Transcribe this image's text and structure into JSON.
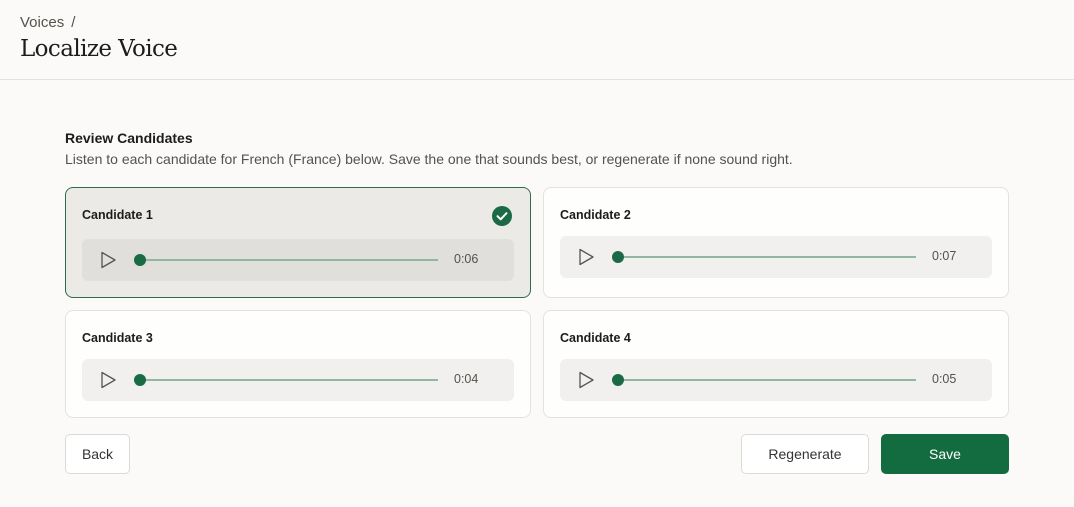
{
  "header": {
    "breadcrumb": "Voices",
    "breadcrumb_separator": "/",
    "title": "Localize Voice"
  },
  "review": {
    "title": "Review Candidates",
    "description": "Listen to each candidate for French (France) below. Save the one that sounds best, or regenerate if none sound right."
  },
  "candidates": [
    {
      "label": "Candidate 1",
      "duration": "0:06",
      "selected": true,
      "progress": 0
    },
    {
      "label": "Candidate 2",
      "duration": "0:07",
      "selected": false,
      "progress": 0
    },
    {
      "label": "Candidate 3",
      "duration": "0:04",
      "selected": false,
      "progress": 0
    },
    {
      "label": "Candidate 4",
      "duration": "0:05",
      "selected": false,
      "progress": 0
    }
  ],
  "actions": {
    "back": "Back",
    "regenerate": "Regenerate",
    "save": "Save"
  },
  "colors": {
    "accent": "#136c40",
    "selected_border": "#2f6c4c",
    "track": "#8fb7a1"
  },
  "icons": {
    "play": "play-icon",
    "check": "check-circle-icon"
  }
}
